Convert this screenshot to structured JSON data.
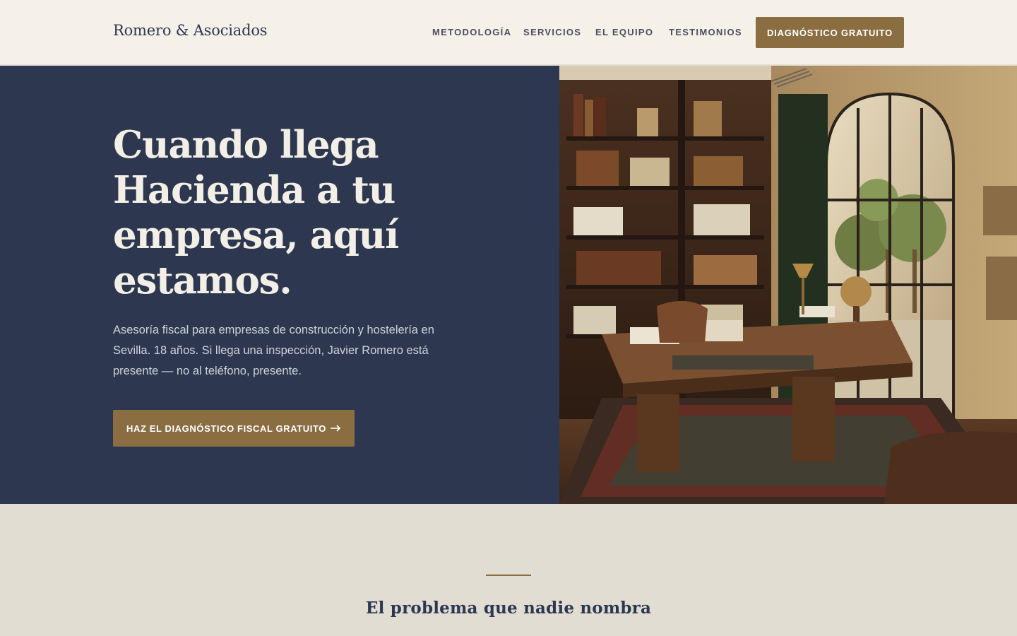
{
  "header": {
    "logo": "Romero & Asociados",
    "nav": [
      "METODOLOGÍA",
      "SERVICIOS",
      "EL EQUIPO",
      "TESTIMONIOS"
    ],
    "cta_label": "DIAGNÓSTICO GRATUITO"
  },
  "hero": {
    "title": "Cuando llega Hacienda a tu empresa, aquí estamos.",
    "subtitle": "Asesoría fiscal para empresas de construcción y hostelería en Sevilla. 18 años. Si llega una inspección, Javier Romero está presente — no al teléfono, presente.",
    "cta_label": "HAZ EL DIAGNÓSTICO FISCAL GRATUITO",
    "cta_icon": "arrow-right-icon"
  },
  "section": {
    "title": "El problema que nadie nombra"
  },
  "colors": {
    "navy": "#2d3850",
    "gold": "#8b6d42",
    "cream": "#f5f1e8",
    "sand": "#e2ddd3"
  }
}
